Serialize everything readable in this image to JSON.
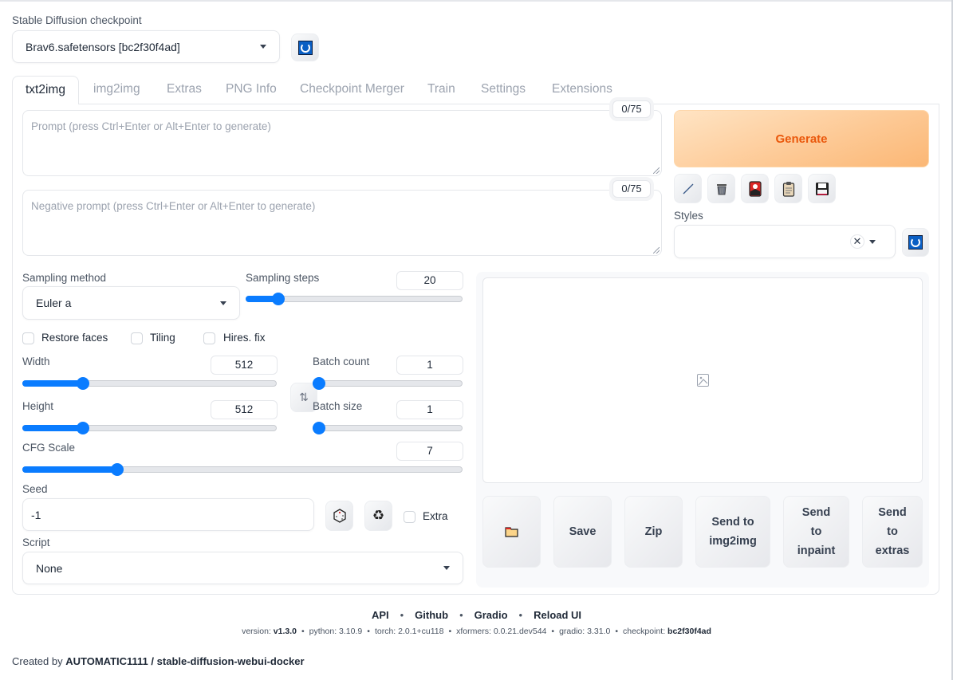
{
  "checkpoint": {
    "label": "Stable Diffusion checkpoint",
    "value": "Brav6.safetensors [bc2f30f4ad]"
  },
  "tabs": [
    {
      "label": "txt2img",
      "active": true
    },
    {
      "label": "img2img",
      "active": false
    },
    {
      "label": "Extras",
      "active": false
    },
    {
      "label": "PNG Info",
      "active": false
    },
    {
      "label": "Checkpoint Merger",
      "active": false
    },
    {
      "label": "Train",
      "active": false
    },
    {
      "label": "Settings",
      "active": false
    },
    {
      "label": "Extensions",
      "active": false
    }
  ],
  "prompt": {
    "placeholder": "Prompt (press Ctrl+Enter or Alt+Enter to generate)",
    "value": "",
    "counter": "0/75"
  },
  "negative_prompt": {
    "placeholder": "Negative prompt (press Ctrl+Enter or Alt+Enter to generate)",
    "value": "",
    "counter": "0/75"
  },
  "generate_label": "Generate",
  "tool_icons": [
    "pencil-icon",
    "trash-icon",
    "picture-card-icon",
    "clipboard-icon",
    "floppy-disk-icon"
  ],
  "styles": {
    "label": "Styles",
    "value": ""
  },
  "sampling_method": {
    "label": "Sampling method",
    "value": "Euler a"
  },
  "sampling_steps": {
    "label": "Sampling steps",
    "value": "20",
    "min": 1,
    "max": 150
  },
  "checkboxes": {
    "restore_faces": {
      "label": "Restore faces",
      "checked": false
    },
    "tiling": {
      "label": "Tiling",
      "checked": false
    },
    "hires_fix": {
      "label": "Hires. fix",
      "checked": false
    },
    "extra": {
      "label": "Extra",
      "checked": false
    }
  },
  "width": {
    "label": "Width",
    "value": "512",
    "min": 64,
    "max": 2048
  },
  "height": {
    "label": "Height",
    "value": "512",
    "min": 64,
    "max": 2048
  },
  "batch_count": {
    "label": "Batch count",
    "value": "1",
    "min": 1,
    "max": 100
  },
  "batch_size": {
    "label": "Batch size",
    "value": "1",
    "min": 1,
    "max": 8
  },
  "cfg_scale": {
    "label": "CFG Scale",
    "value": "7",
    "min": 1,
    "max": 30
  },
  "seed": {
    "label": "Seed",
    "value": "-1"
  },
  "script": {
    "label": "Script",
    "value": "None"
  },
  "output_buttons": {
    "open_folder": "folder-icon",
    "save": "Save",
    "zip": "Zip",
    "send_img2img": "Send to img2img",
    "send_inpaint": "Send to inpaint",
    "send_extras": "Send to extras"
  },
  "footer": {
    "links": [
      "API",
      "Github",
      "Gradio",
      "Reload UI"
    ],
    "versions": [
      {
        "key": "version:",
        "value": "v1.3.0",
        "bold": true
      },
      {
        "key": "python:",
        "value": "3.10.9",
        "bold": false
      },
      {
        "key": "torch:",
        "value": "2.0.1+cu118",
        "bold": false
      },
      {
        "key": "xformers:",
        "value": "0.0.21.dev544",
        "bold": false
      },
      {
        "key": "gradio:",
        "value": "3.31.0",
        "bold": false
      },
      {
        "key": "checkpoint:",
        "value": "bc2f30f4ad",
        "bold": true
      }
    ],
    "credits_prefix": "Created by",
    "credits_author": "AUTOMATIC1111",
    "credits_sep": "/",
    "credits_repo": "stable-diffusion-webui-docker"
  },
  "colors": {
    "accent": "#0a7cff",
    "generate_text": "#ea580c",
    "generate_bg": "#fdc893"
  }
}
